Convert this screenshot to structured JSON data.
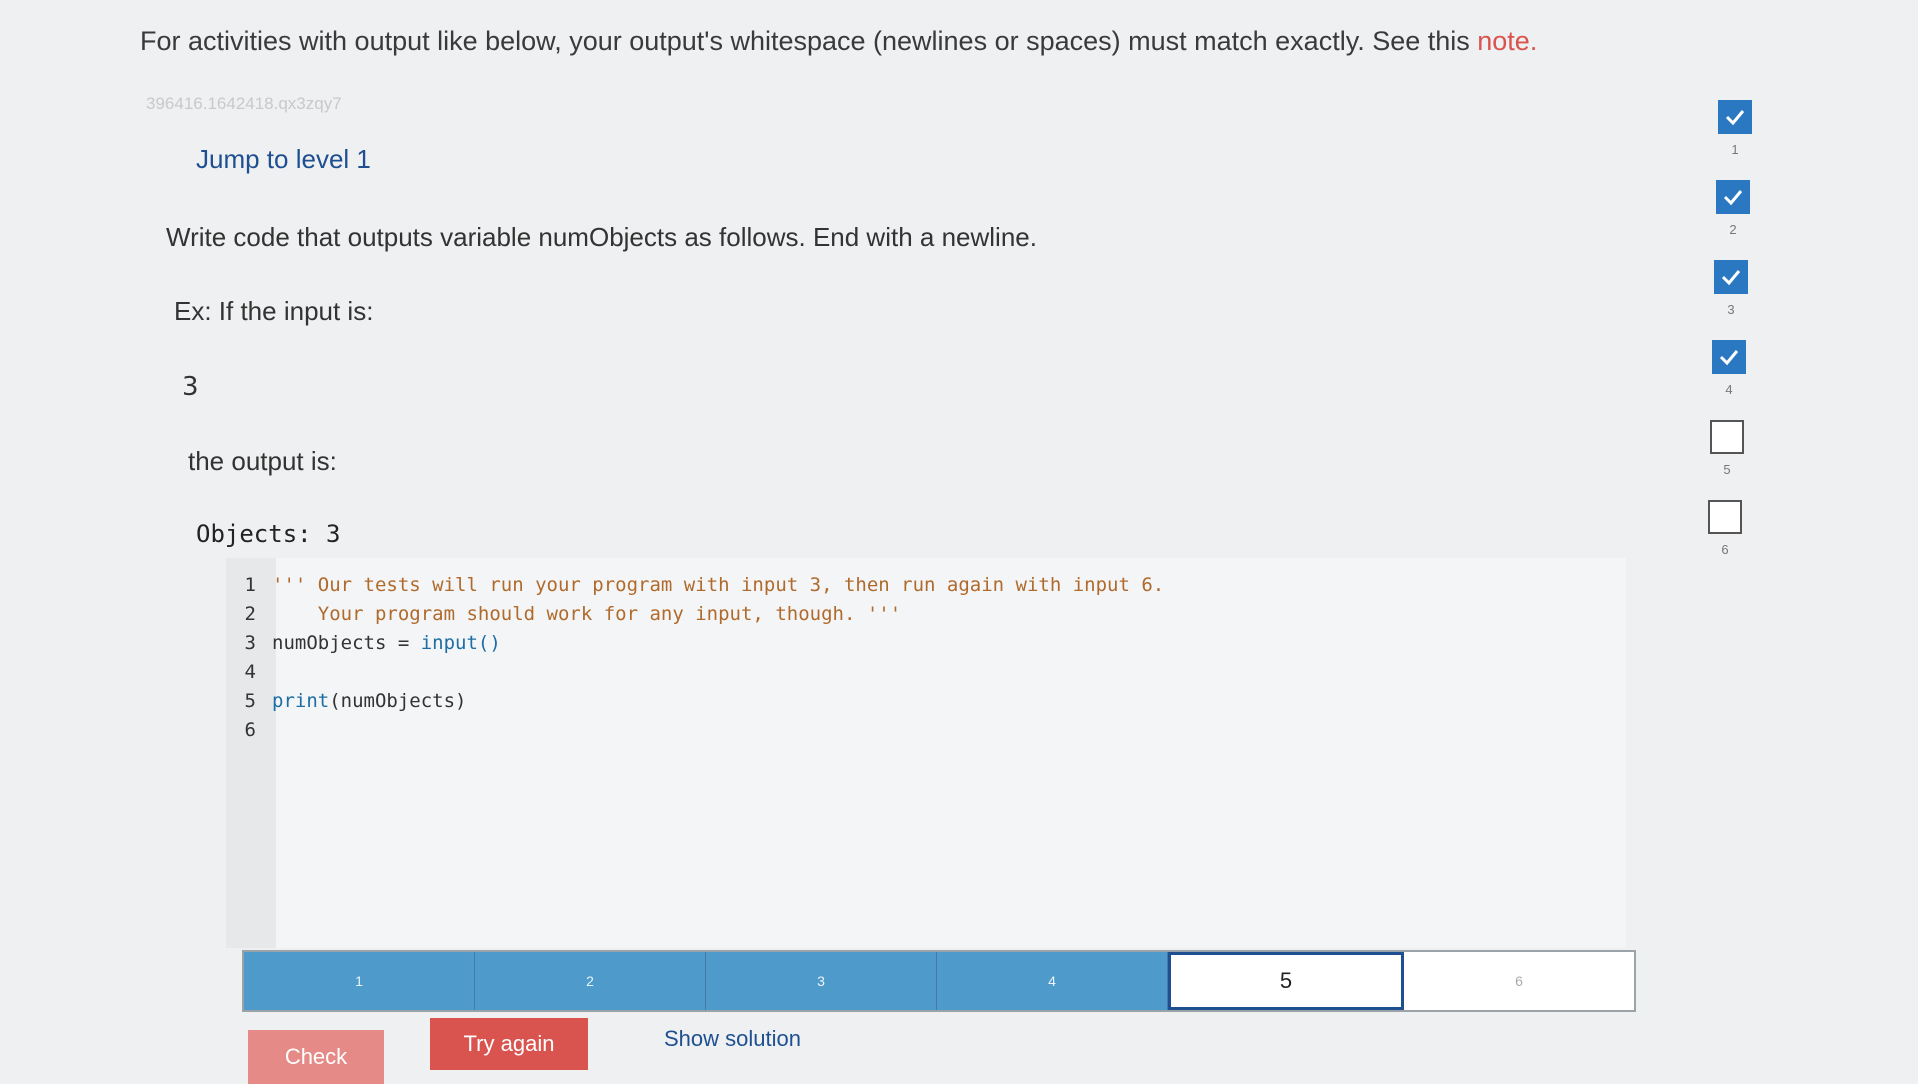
{
  "header": {
    "instruction_text": "For activities with output like below, your output's whitespace (newlines or spaces) must match exactly. See this ",
    "note_link": "note."
  },
  "activity_id": "396416.1642418.qx3zqy7",
  "jump_link": "Jump to level 1",
  "task": {
    "instruction": "Write code that outputs variable numObjects as follows. End with a newline.",
    "example_label": "Ex: If the input is:",
    "example_input": "3",
    "output_label": "the output is:",
    "example_output": "Objects: 3"
  },
  "code_editor": {
    "lines": [
      {
        "num": "1",
        "parts": [
          {
            "t": "''' Our tests will run your program with input 3, then run again with input 6.",
            "c": "cmt"
          }
        ]
      },
      {
        "num": "2",
        "parts": [
          {
            "t": "    Your program should work for any input, though. '''",
            "c": "cmt"
          }
        ]
      },
      {
        "num": "3",
        "parts": [
          {
            "t": "numObjects = ",
            "c": "txt"
          },
          {
            "t": "input()",
            "c": "kw"
          }
        ]
      },
      {
        "num": "4",
        "parts": []
      },
      {
        "num": "5",
        "parts": [
          {
            "t": "print",
            "c": "kw"
          },
          {
            "t": "(numObjects)",
            "c": "txt"
          }
        ]
      },
      {
        "num": "6",
        "parts": []
      }
    ]
  },
  "levels": {
    "items": [
      "1",
      "2",
      "3",
      "4",
      "5",
      "6"
    ],
    "current": "5",
    "completed": 4
  },
  "buttons": {
    "check": "Check",
    "try_again": "Try again",
    "show_solution": "Show solution"
  },
  "progress_steps": [
    {
      "num": "1",
      "done": true
    },
    {
      "num": "2",
      "done": true
    },
    {
      "num": "3",
      "done": true
    },
    {
      "num": "4",
      "done": true
    },
    {
      "num": "5",
      "done": false
    },
    {
      "num": "6",
      "done": false
    }
  ],
  "colors": {
    "accent_blue": "#2a78c2",
    "level_blue": "#4e9acb",
    "button_red": "#d9534f",
    "link_blue": "#1e4f91"
  }
}
